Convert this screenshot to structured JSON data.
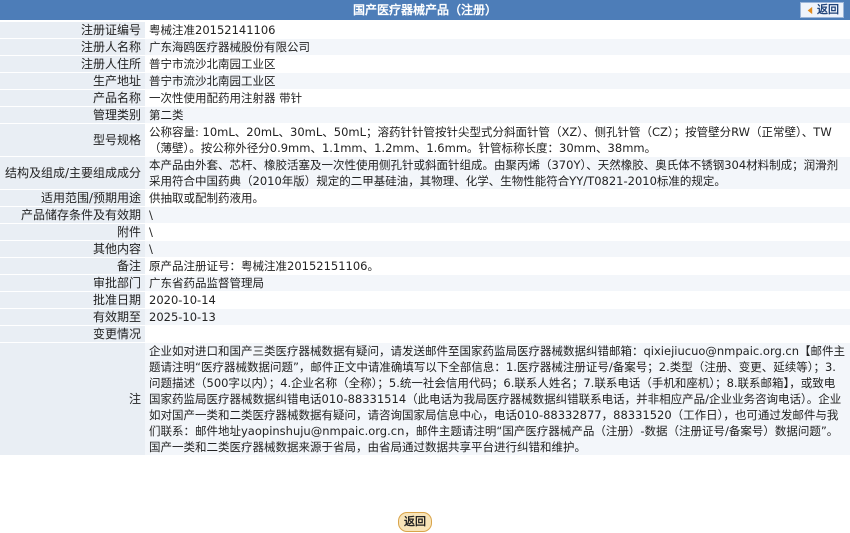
{
  "header": {
    "title": "国产医疗器械产品（注册）",
    "back_label": "返回"
  },
  "rows": [
    {
      "label": "注册证编号",
      "value": "粤械注准20152141106"
    },
    {
      "label": "注册人名称",
      "value": "广东海鸥医疗器械股份有限公司"
    },
    {
      "label": "注册人住所",
      "value": "普宁市流沙北南园工业区"
    },
    {
      "label": "生产地址",
      "value": "普宁市流沙北南园工业区"
    },
    {
      "label": "产品名称",
      "value": "一次性使用配药用注射器 带针"
    },
    {
      "label": "管理类别",
      "value": "第二类"
    },
    {
      "label": "型号规格",
      "value": "公称容量: 10mL、20mL、30mL、50mL；溶药针针管按针尖型式分斜面针管（XZ）、侧孔针管（CZ）；按管壁分RW（正常壁）、TW（薄壁）。按公称外径分0.9mm、1.1mm、1.2mm、1.6mm。针管标称长度：30mm、38mm。"
    },
    {
      "label": "结构及组成/主要组成成分",
      "value": "本产品由外套、芯杆、橡胶活塞及一次性使用侧孔针或斜面针组成。由聚丙烯（370Y）、天然橡胶、奥氏体不锈钢304材料制成；润滑剂采用符合中国药典（2010年版）规定的二甲基硅油，其物理、化学、生物性能符合YY/T0821-2010标准的规定。"
    },
    {
      "label": "适用范围/预期用途",
      "value": "供抽取或配制药液用。"
    },
    {
      "label": "产品储存条件及有效期",
      "value": "\\"
    },
    {
      "label": "附件",
      "value": "\\"
    },
    {
      "label": "其他内容",
      "value": "\\"
    },
    {
      "label": "备注",
      "value": "原产品注册证号：粤械注准20152151106。"
    },
    {
      "label": "审批部门",
      "value": "广东省药品监督管理局"
    },
    {
      "label": "批准日期",
      "value": "2020-10-14"
    },
    {
      "label": "有效期至",
      "value": "2025-10-13"
    },
    {
      "label": "变更情况",
      "value": ""
    }
  ],
  "note": {
    "label": "注",
    "text": "企业如对进口和国产三类医疗器械数据有疑问，请发送邮件至国家药监局医疗器械数据纠错邮箱：qixiejiucuo@nmpaic.org.cn【邮件主题请注明“医疗器械数据问题”，邮件正文中请准确填写以下全部信息：1.医疗器械注册证号/备案号；2.类型（注册、变更、延续等）；3.问题描述（500字以内）；4.企业名称（全称）；5.统一社会信用代码；6.联系人姓名；7.联系电话（手机和座机）；8.联系邮箱】，或致电国家药监局医疗器械数据纠错电话010-88331514（此电话为我局医疗器械数据纠错联系电话，并非相应产品/企业业务咨询电话）。企业如对国产一类和二类医疗器械数据有疑问，请咨询国家局信息中心，电话010-88332877，88331520（工作日），也可通过发邮件与我们联系：邮件地址yaopinshuju@nmpaic.org.cn，邮件主题请注明“国产医疗器械产品（注册）-数据（注册证号/备案号）数据问题”。国产一类和二类医疗器械数据来源于省局，由省局通过数据共享平台进行纠错和维护。"
  },
  "footer": {
    "back_label": "返回"
  }
}
